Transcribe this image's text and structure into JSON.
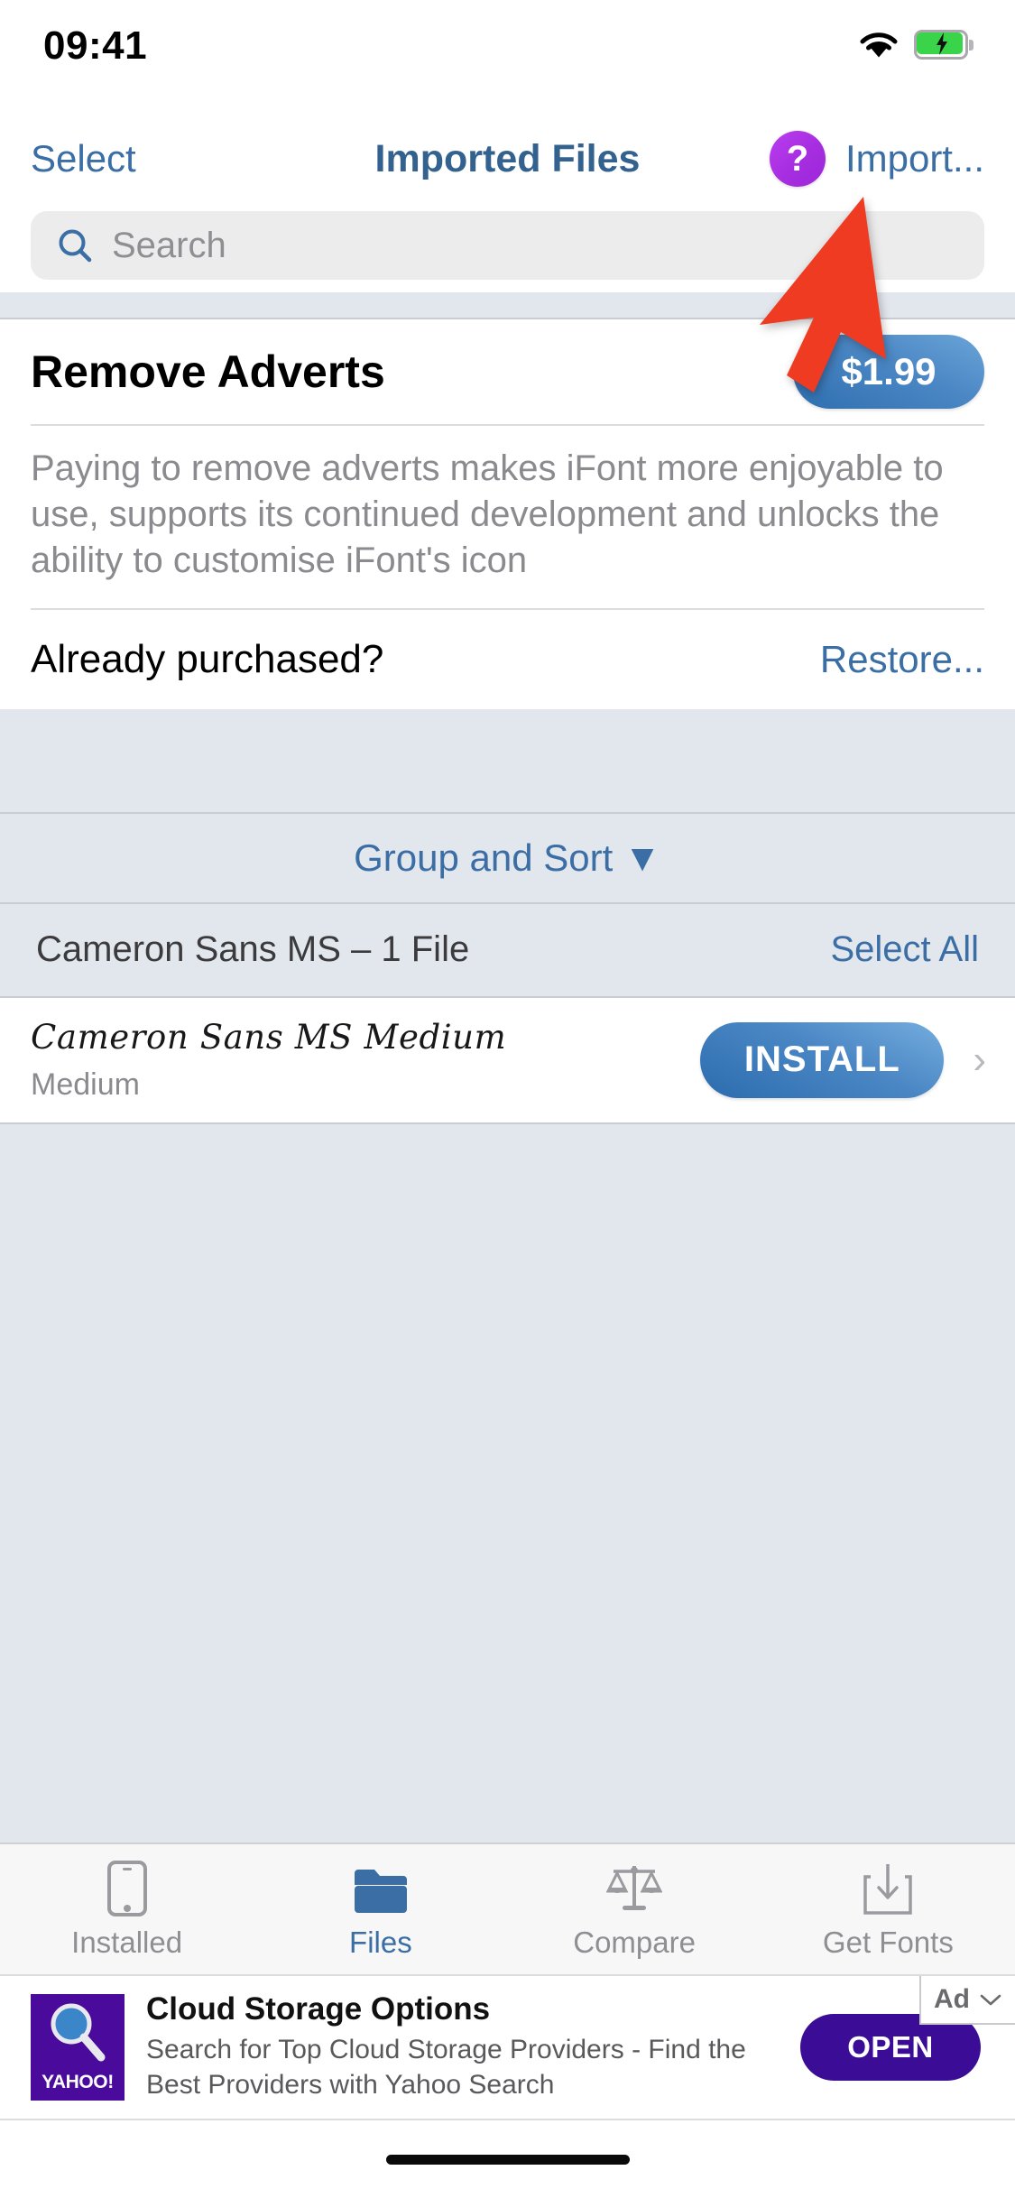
{
  "status_bar": {
    "time": "09:41",
    "wifi_icon": "wifi-icon",
    "battery_icon": "battery-charging-icon"
  },
  "nav_bar": {
    "left_button": "Select",
    "title": "Imported Files",
    "help_icon_label": "?",
    "right_button": "Import...",
    "tint_color": "#3a6ea5",
    "help_icon_color": "#a62ee0"
  },
  "search": {
    "placeholder": "Search",
    "value": "",
    "icon": "search-icon"
  },
  "promo": {
    "title": "Remove Adverts",
    "price": "$1.99",
    "description": "Paying to remove adverts makes iFont more enjoyable to use, supports its continued development and unlocks the ability to customise iFont's icon",
    "restore_question": "Already purchased?",
    "restore_action": "Restore..."
  },
  "group_sort": {
    "label": "Group and Sort",
    "caret": "▼"
  },
  "font_group": {
    "header_title": "Cameron Sans MS – 1 File",
    "header_action": "Select All",
    "rows": [
      {
        "sample": "Cameron Sans MS Medium",
        "style": "Medium",
        "action": "INSTALL",
        "chevron": "›"
      }
    ]
  },
  "tab_bar": {
    "tabs": [
      {
        "label": "Installed",
        "icon": "phone-icon",
        "active": false
      },
      {
        "label": "Files",
        "icon": "folder-icon",
        "active": true
      },
      {
        "label": "Compare",
        "icon": "scales-icon",
        "active": false
      },
      {
        "label": "Get Fonts",
        "icon": "download-tray-icon",
        "active": false
      }
    ],
    "active_color": "#3a6ea5",
    "inactive_color": "#8e8e93"
  },
  "ad_banner": {
    "brand": "YAHOO!",
    "title": "Cloud Storage Options",
    "description": "Search for Top Cloud Storage Providers - Find the Best Providers with Yahoo Search",
    "cta": "OPEN",
    "badge_label": "Ad",
    "badge_caret": "⌄",
    "brand_color": "#4a0a9c"
  },
  "annotation": {
    "arrow_color": "#ee3b22",
    "points_to": "Import... button"
  }
}
